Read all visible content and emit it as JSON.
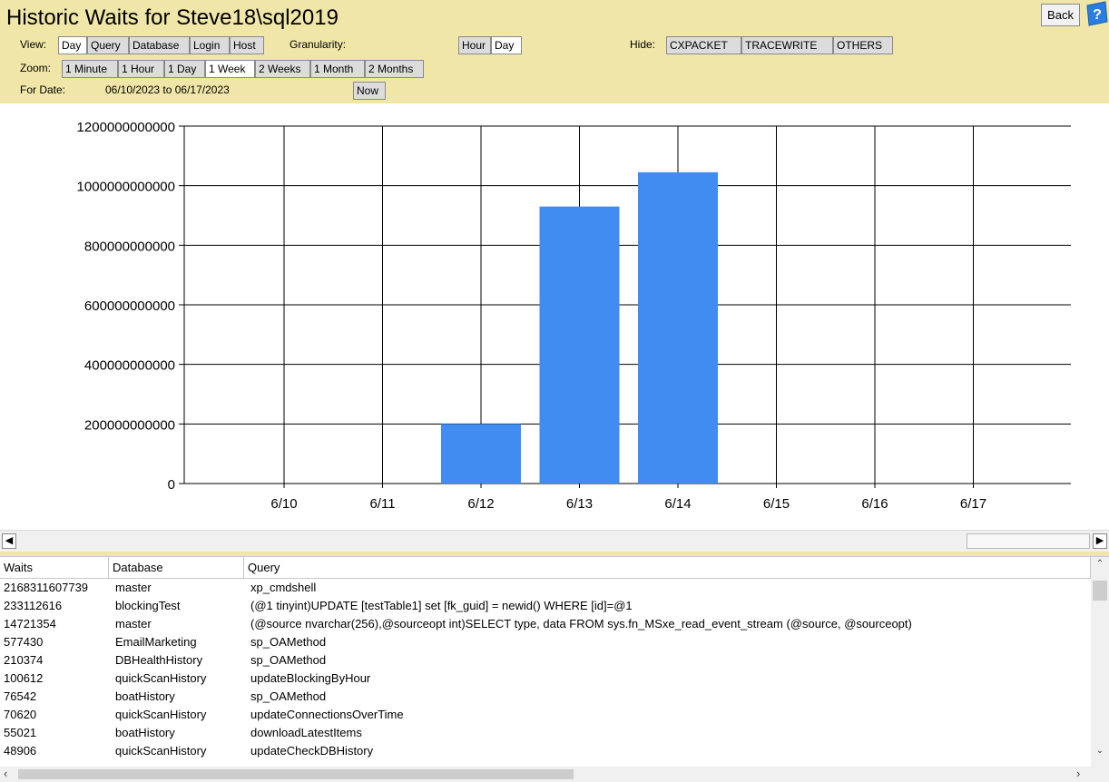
{
  "window": {
    "title": "Historic Waits for Steve18\\sql2019"
  },
  "header": {
    "back_label": "Back",
    "view_label": "View:",
    "view_buttons": [
      "Day",
      "Query",
      "Database",
      "Login",
      "Host"
    ],
    "granularity_label": "Granularity:",
    "granularity_buttons": [
      "Hour",
      "Day"
    ],
    "hide_label": "Hide:",
    "hide_buttons": [
      "CXPACKET",
      "TRACEWRITE",
      "OTHERS"
    ],
    "zoom_label": "Zoom:",
    "zoom_buttons": [
      "1 Minute",
      "1 Hour",
      "1 Day",
      "1 Week",
      "2 Weeks",
      "1 Month",
      "2 Months"
    ],
    "for_date_label": "For Date:",
    "date_range": "06/10/2023 to 06/17/2023",
    "now_label": "Now",
    "selected_view": "Day",
    "selected_granularity": "Day",
    "selected_zoom": "1 Week"
  },
  "chart_data": {
    "type": "bar",
    "categories": [
      "6/10",
      "6/11",
      "6/12",
      "6/13",
      "6/14",
      "6/15",
      "6/16",
      "6/17"
    ],
    "values": [
      0,
      0,
      200000000000,
      930000000000,
      1045000000000,
      0,
      0,
      0
    ],
    "ylim": [
      0,
      1200000000000
    ],
    "yticks": [
      "0",
      "200000000000",
      "400000000000",
      "600000000000",
      "800000000000",
      "1000000000000",
      "1200000000000"
    ],
    "grid": true,
    "bar_color": "#418cf0"
  },
  "grid": {
    "columns": [
      "Waits",
      "Database",
      "Query"
    ],
    "rows": [
      [
        "2168311607739",
        "master",
        "xp_cmdshell"
      ],
      [
        "233112616",
        "blockingTest",
        "(@1 tinyint)UPDATE [testTable1] set [fk_guid] = newid()  WHERE [id]=@1"
      ],
      [
        "14721354",
        "master",
        "(@source nvarchar(256),@sourceopt int)SELECT type, data FROM sys.fn_MSxe_read_event_stream (@source, @sourceopt)"
      ],
      [
        "577430",
        "EmailMarketing",
        "sp_OAMethod"
      ],
      [
        "210374",
        "DBHealthHistory",
        "sp_OAMethod"
      ],
      [
        "100612",
        "quickScanHistory",
        "updateBlockingByHour"
      ],
      [
        "76542",
        "boatHistory",
        "sp_OAMethod"
      ],
      [
        "70620",
        "quickScanHistory",
        "updateConnectionsOverTime"
      ],
      [
        "55021",
        "boatHistory",
        "downloadLatestItems"
      ],
      [
        "48906",
        "quickScanHistory",
        "updateCheckDBHistory"
      ]
    ]
  }
}
